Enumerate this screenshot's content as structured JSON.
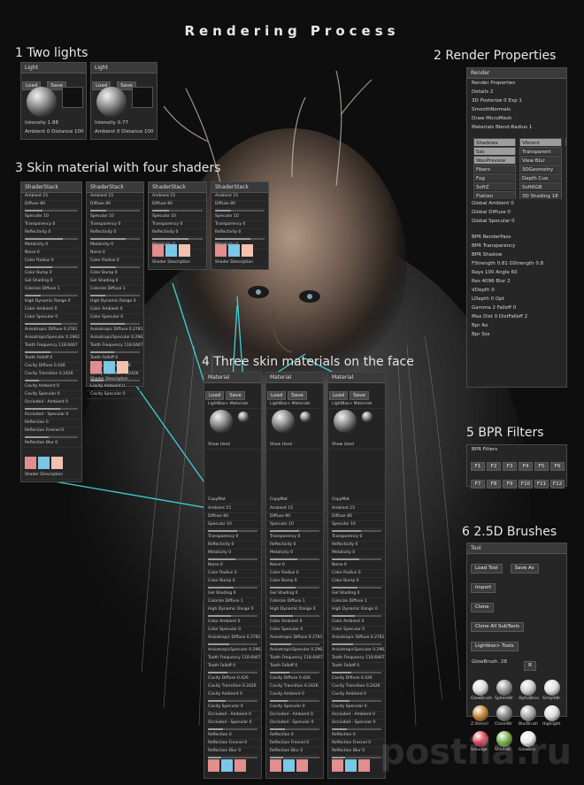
{
  "page": {
    "title": "Rendering Process"
  },
  "sections": [
    {
      "label": "1 Two lights"
    },
    {
      "label": "2 Render Properties"
    },
    {
      "label": "3 Skin material with four shaders"
    },
    {
      "label": "4 Three skin materials on the face"
    },
    {
      "label": "5 BPR Filters"
    },
    {
      "label": "6 2.5D Brushes"
    }
  ],
  "lights": {
    "title": "Light",
    "load": "Load",
    "save": "Save",
    "panels": [
      {
        "intensity_label": "Intensity",
        "intensity": "1.88",
        "ambient_label": "Ambient",
        "ambient": "0",
        "distance_label": "Distance",
        "distance": "100"
      },
      {
        "intensity_label": "Intensity",
        "intensity": "0.77",
        "ambient_label": "Ambient",
        "ambient": "0",
        "distance_label": "Distance",
        "distance": "100"
      }
    ]
  },
  "render": {
    "title": "Render",
    "sub": "Render Properties",
    "rows": [
      "Details 2",
      "3D Posterize 0   Exp 1",
      "SmoothNormals",
      "Draw MicroMesh",
      "Materials Blend-Radius 1"
    ],
    "grid": [
      [
        "Shadows",
        "Vibrant",
        "AOcclusion"
      ],
      [
        "Sss",
        "Transparent",
        ""
      ],
      [
        "WaxPreview",
        "View Blur",
        ""
      ],
      [
        "Fibers",
        "3DGeometry",
        ""
      ],
      [
        "Fog",
        "Depth Cue",
        ""
      ],
      [
        "SoftZ",
        "SoftRGB",
        ""
      ],
      [
        "Flatten",
        "3D Shading 18",
        ""
      ]
    ],
    "grid_on": [
      "Shadows",
      "Vibrant",
      "AOcclusion",
      "Sss",
      "WaxPreview"
    ],
    "globals": [
      "Global Ambient 0",
      "Global Diffuse 0",
      "Global Specular 0"
    ],
    "bpr": [
      "BPR RenderPass",
      "BPR Transparency",
      "BPR Shadow"
    ],
    "shadow_rows": [
      "FStrength 0.81  GStrength 0.8",
      "Rays 100   Angle 60",
      "Res 4096   Blur 2",
      "VDepth 0",
      "LDepth 0   Opt",
      "Gamma 2   Falloff 0",
      "Max Dist 0   DistFalloff 2",
      "Bpr Ao",
      "Bpr Sss"
    ]
  },
  "filters": {
    "title": "BPR Filters",
    "labels": [
      "F1",
      "F2",
      "F3",
      "F4",
      "F5",
      "F6",
      "F7",
      "F8",
      "F9",
      "F10",
      "F11",
      "F12"
    ]
  },
  "tool": {
    "title": "Tool",
    "buttons": [
      "Load Tool",
      "Save As",
      "Import",
      "Clone",
      "Clone All SubTools",
      "Lightbox> Tools"
    ],
    "current": "GlowBrush",
    "size": "28",
    "size_value": "R",
    "brushes": [
      "GlowBrush",
      "SphereBr",
      "AlphaBrus",
      "SimpleBr",
      "Z.Stencil",
      "ClosedBr",
      "BlurBrush",
      "Highlight",
      "Smudge",
      "ShadeBr",
      "GlowBru"
    ]
  },
  "shader_panels": {
    "header": "ShaderStack",
    "rows": [
      "Ambient 15",
      "Diffuse 80",
      "Specular 10",
      "Transparency 0",
      "Reflectivity 0",
      "Metalicity 0",
      "Noise 0",
      "Color Radius 0",
      "Color Bump 0",
      "Gel Shading 0",
      "Colorize Diffuse 1",
      "High Dynamic Range 0",
      "Color Ambient 0",
      "Color Specular 0",
      "Anisotropic Diffuse 0.2781",
      "AnisotropicSpecular 0.2962",
      "Tooth Frequency 118.6467",
      "Tooth Falloff 0",
      "Cavity Diffuse 0.426",
      "Cavity Transition 0.2426",
      "Cavity Ambient 0",
      "Cavity Specular 0",
      "Occluded - Ambient 0",
      "Occluded - Specular 0",
      "Reflection 0",
      "Reflection Fresnel 0",
      "Reflection Blur 0"
    ],
    "desc": "Shader Description"
  },
  "face_panels": {
    "material_title": "Material",
    "load": "Load",
    "save": "Save",
    "names": [
      "LightBox> Materials",
      "LightBox> Materials",
      "LightBox> Materials"
    ],
    "show_used": "Show Used",
    "copymat": "CopyMat"
  },
  "watermark": "postila.ru",
  "colors": {
    "line": "#3fd0d8",
    "swatch_pink": "#e08e8e",
    "swatch_blue": "#7ac7e6",
    "swatch_peach": "#f3c1b0"
  }
}
